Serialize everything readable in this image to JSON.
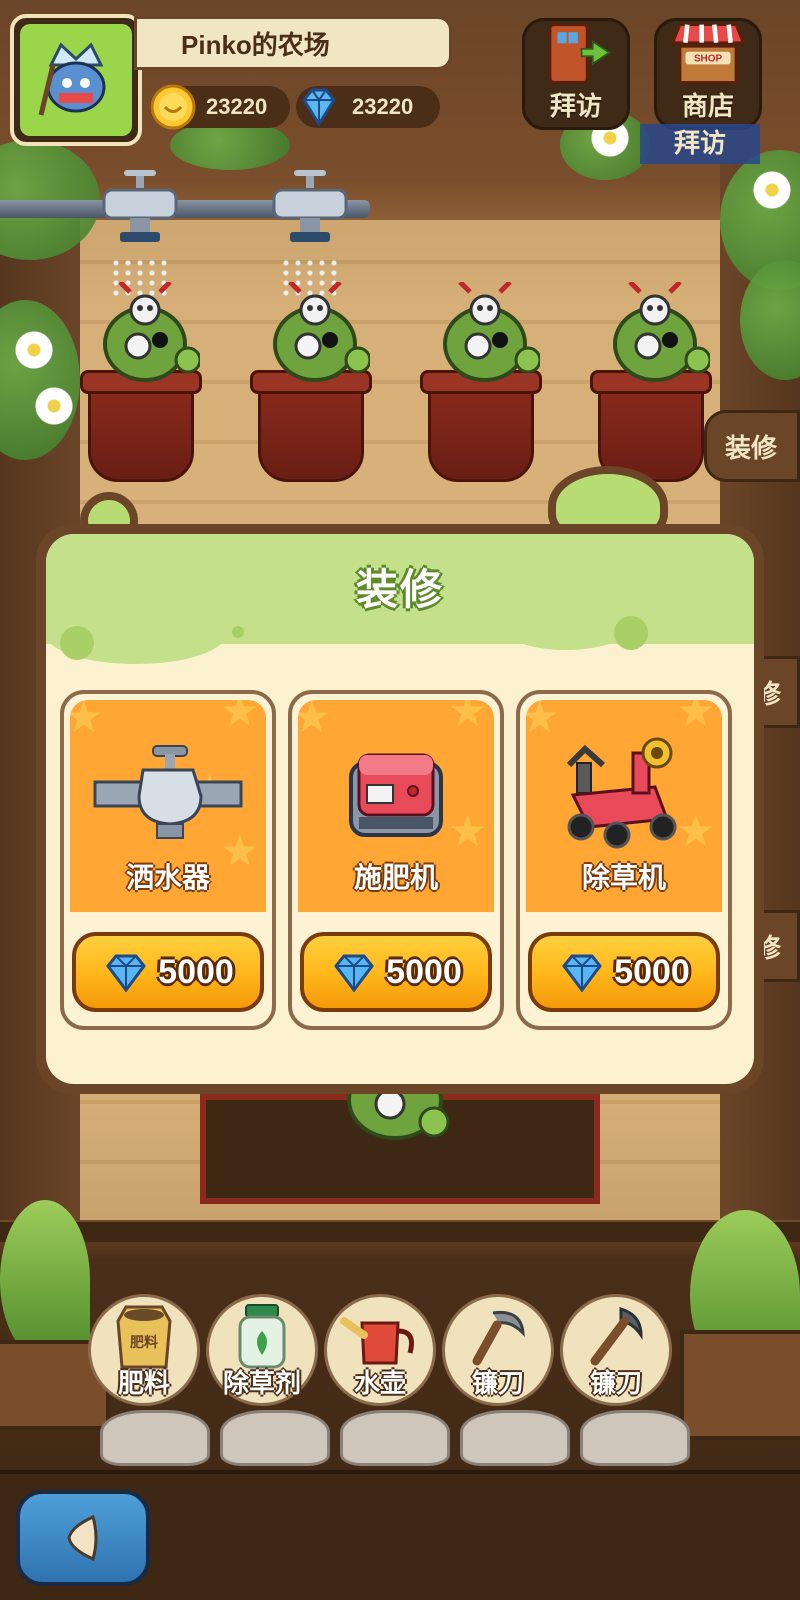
{
  "header": {
    "farm_name": "Pinko的农场",
    "coins": "23220",
    "gems": "23220"
  },
  "top_buttons": {
    "visit_label": "拜访",
    "shop_label": "商店",
    "shop_sign": "SHOP",
    "overlap_visit_label": "拜访"
  },
  "side": {
    "decorate_label": "装修",
    "peek_label_1": "修",
    "peek_label_2": "修"
  },
  "modal": {
    "title": "装修",
    "items": [
      {
        "name": "洒水器",
        "price": "5000",
        "icon": "sprinkler-icon"
      },
      {
        "name": "施肥机",
        "price": "5000",
        "icon": "fertilizer-machine-icon"
      },
      {
        "name": "除草机",
        "price": "5000",
        "icon": "lawn-mower-icon"
      }
    ]
  },
  "tools": [
    {
      "label": "肥料",
      "icon": "fertilizer-bag-icon",
      "bag_text": "肥料"
    },
    {
      "label": "除草剂",
      "icon": "herbicide-jar-icon"
    },
    {
      "label": "水壶",
      "icon": "watering-can-icon"
    },
    {
      "label": "镰刀",
      "icon": "sickle-icon"
    },
    {
      "label": "镰刀",
      "icon": "pickaxe-icon"
    }
  ],
  "colors": {
    "card_orange": "#ffa634",
    "button_gold": "#ffb81c",
    "slime_green": "#c4e08a",
    "wood_dark": "#6b4528",
    "back_button_blue": "#2f73b0"
  }
}
